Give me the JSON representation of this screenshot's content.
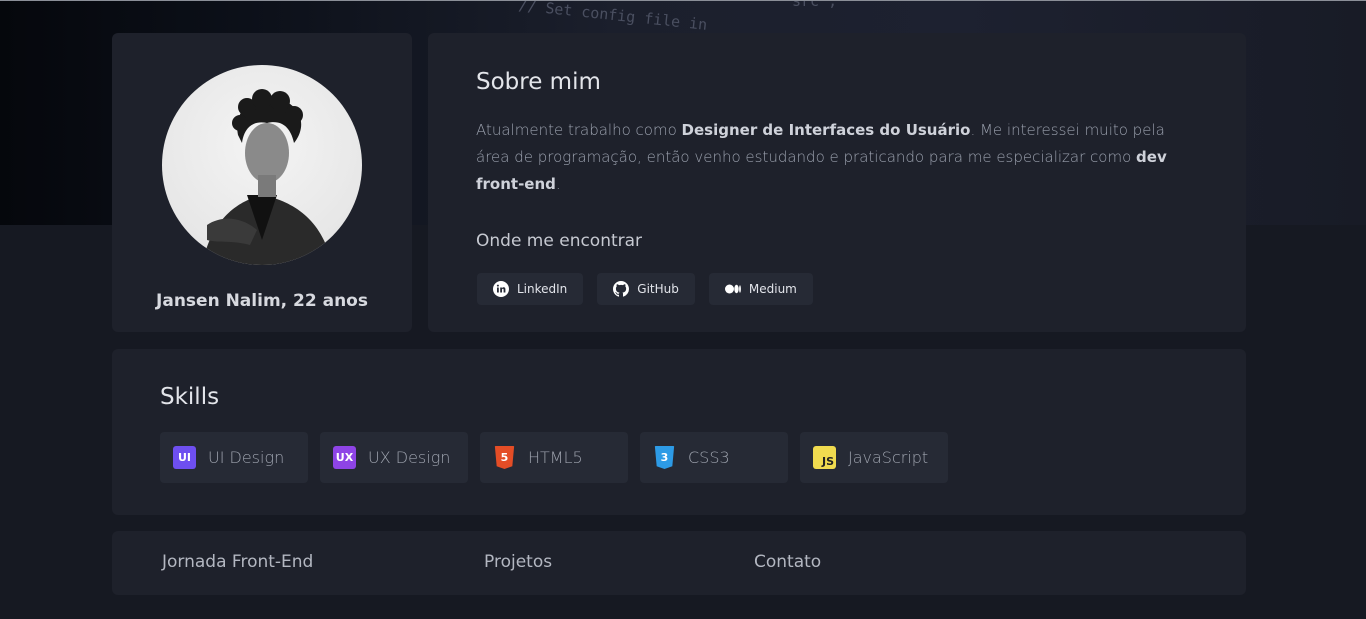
{
  "profile": {
    "name": "Jansen Nalim, 22 anos"
  },
  "about": {
    "title": "Sobre mim",
    "text_1": "Atualmente trabalho como ",
    "text_bold_1": "Designer de Interfaces do Usuário",
    "text_2": ". Me interessei muito pela área de programação, então venho estudando e praticando para me especializar como ",
    "text_bold_2": "dev front-end",
    "text_3": ".",
    "find_title": "Onde me encontrar",
    "socials": [
      {
        "label": "LinkedIn",
        "icon": "linkedin-icon"
      },
      {
        "label": "GitHub",
        "icon": "github-icon"
      },
      {
        "label": "Medium",
        "icon": "medium-icon"
      }
    ]
  },
  "skills": {
    "title": "Skills",
    "items": [
      {
        "label": "UI Design",
        "badge": "UI",
        "color": "#6e4ff0"
      },
      {
        "label": "UX Design",
        "badge": "UX",
        "color": "#8e44e6"
      },
      {
        "label": "HTML5",
        "badge": "5",
        "color": "#e44d26"
      },
      {
        "label": "CSS3",
        "badge": "3",
        "color": "#2d9be6"
      },
      {
        "label": "JavaScript",
        "badge": "JS",
        "color": "#f0db4f"
      }
    ]
  },
  "nav": {
    "items": [
      "Jornada Front-End",
      "Projetos",
      "Contato"
    ]
  },
  "hero": {
    "code_1": "// Set config file in",
    "code_2": "src\";"
  }
}
